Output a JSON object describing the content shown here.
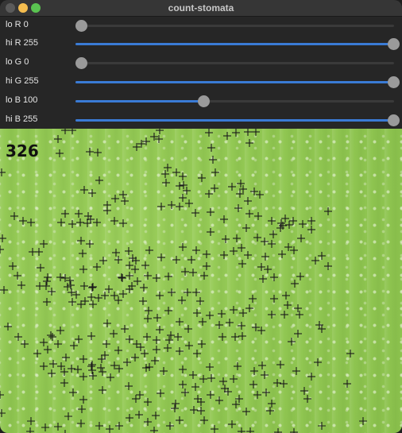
{
  "window": {
    "title": "count-stomata",
    "traffic_lights": [
      "close",
      "minimize",
      "maximize"
    ]
  },
  "sliders": [
    {
      "name": "lo R",
      "label": "lo R 0",
      "value": 0,
      "min": 0,
      "max": 255
    },
    {
      "name": "hi R",
      "label": "hi R 255",
      "value": 255,
      "min": 0,
      "max": 255
    },
    {
      "name": "lo G",
      "label": "lo G 0",
      "value": 0,
      "min": 0,
      "max": 255
    },
    {
      "name": "hi G",
      "label": "hi G 255",
      "value": 255,
      "min": 0,
      "max": 255
    },
    {
      "name": "lo B",
      "label": "lo B 100",
      "value": 100,
      "min": 0,
      "max": 255
    },
    {
      "name": "hi B",
      "label": "hi B 255",
      "value": 255,
      "min": 0,
      "max": 255
    }
  ],
  "viewer": {
    "count": "326",
    "marker": "plus-cross",
    "marker_color": "#1a1a1a"
  },
  "colors": {
    "accent": "#3a7bd5",
    "thumb": "#9a9a9a",
    "panel": "#262626",
    "leaf": "#92c853"
  }
}
